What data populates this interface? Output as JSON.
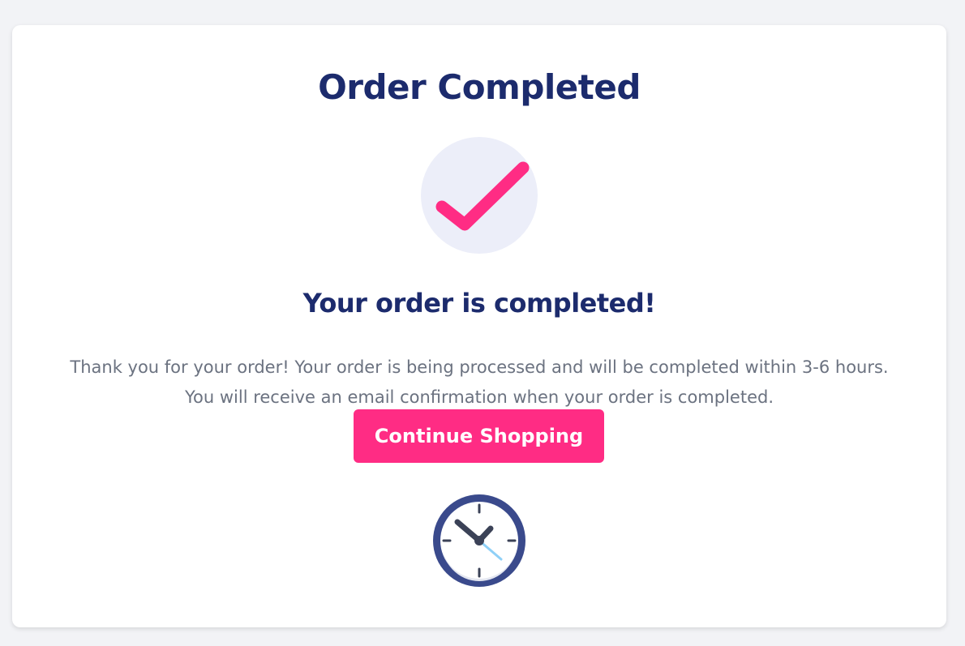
{
  "page": {
    "title": "Order Completed",
    "subtitle": "Your order is completed!",
    "message_line1": "Thank you for your order! Your order is being processed and will be completed within 3-6 hours.",
    "message_line2": "You will receive an email confirmation when your order is completed.",
    "continue_button_label": "Continue Shopping"
  },
  "icons": {
    "success": "checkmark-icon",
    "pending": "clock-icon"
  },
  "colors": {
    "title": "#1c2b6d",
    "accent": "#ff2c84",
    "text_muted": "#6b7280",
    "background": "#f2f3f6",
    "check_circle_bg": "#eceef9",
    "clock_rim": "#3a4a8c"
  }
}
